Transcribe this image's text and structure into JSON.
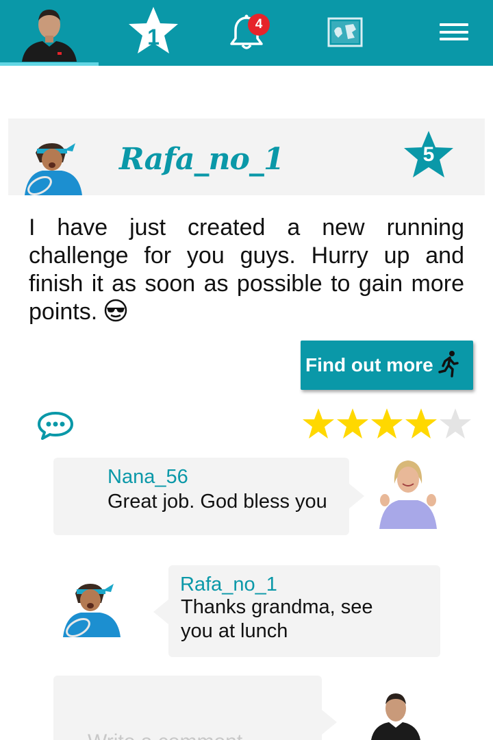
{
  "nav": {
    "items": [
      {
        "name": "profile",
        "icon": "user-avatar"
      },
      {
        "name": "ranking",
        "icon": "star-icon",
        "value": "1"
      },
      {
        "name": "notifications",
        "icon": "bell-icon",
        "badge": "4"
      },
      {
        "name": "map",
        "icon": "map-icon"
      },
      {
        "name": "menu",
        "icon": "hamburger-icon"
      }
    ],
    "ranking_label": "1",
    "notification_count": "4",
    "active_index": 0
  },
  "post": {
    "username": "Rafa_no_1",
    "score": "5",
    "text": "I have just created a new running challenge for you guys. Hurry up and finish it as soon as possible to gain more points.",
    "emoji": "sunglasses-face-icon",
    "button_label": "Find out more",
    "button_icon": "running-person-icon",
    "rating": 4,
    "rating_max": 5
  },
  "comments": [
    {
      "username": "Nana_56",
      "text": "Great job. God bless you",
      "align": "left"
    },
    {
      "username": "Rafa_no_1",
      "text": "Thanks grandma, see you at lunch",
      "align": "right"
    }
  ],
  "composer": {
    "placeholder": "Write a comment"
  },
  "colors": {
    "accent": "#0a98a8",
    "active_tab_line": "#62d6e4",
    "badge": "#e6242a",
    "star_filled": "#ffd800",
    "star_empty": "#e4e4e4",
    "card_bg": "#f3f3f3"
  }
}
